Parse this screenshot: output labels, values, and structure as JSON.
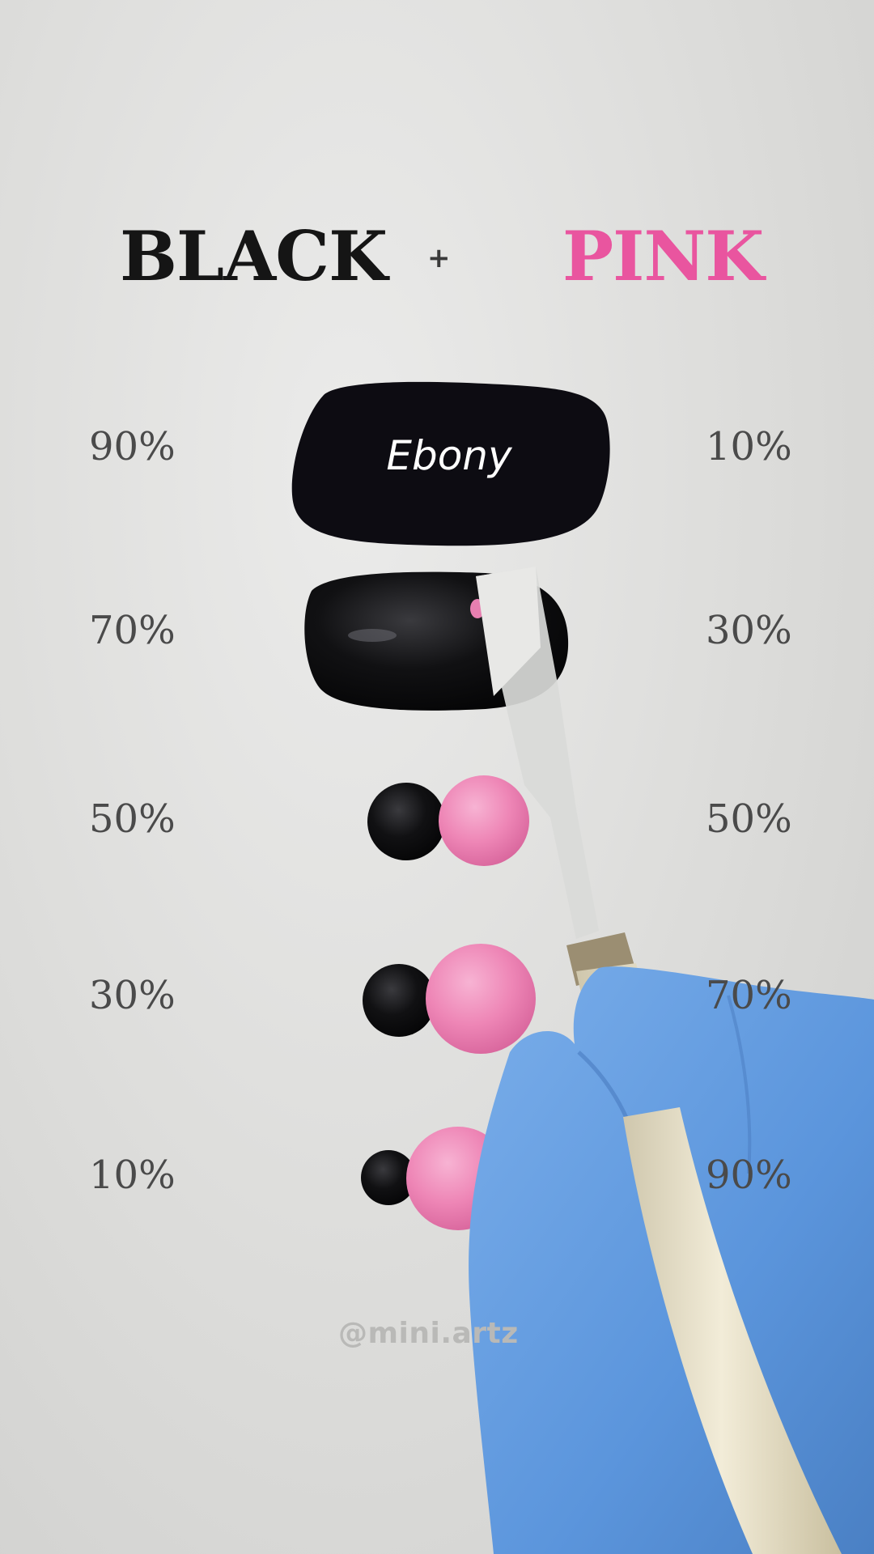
{
  "heading": {
    "left": "BLACK",
    "operator": "+",
    "right": "PINK"
  },
  "colors": {
    "black": "#151515",
    "pink": "#e9559f",
    "background": "#dcdcda",
    "glove": "#5b95dc"
  },
  "swatch_name": "Ebony",
  "rows": [
    {
      "black_pct": "90%",
      "pink_pct": "10%"
    },
    {
      "black_pct": "70%",
      "pink_pct": "30%"
    },
    {
      "black_pct": "50%",
      "pink_pct": "50%"
    },
    {
      "black_pct": "30%",
      "pink_pct": "70%"
    },
    {
      "black_pct": "10%",
      "pink_pct": "90%"
    }
  ],
  "watermark": "@mini.artz"
}
